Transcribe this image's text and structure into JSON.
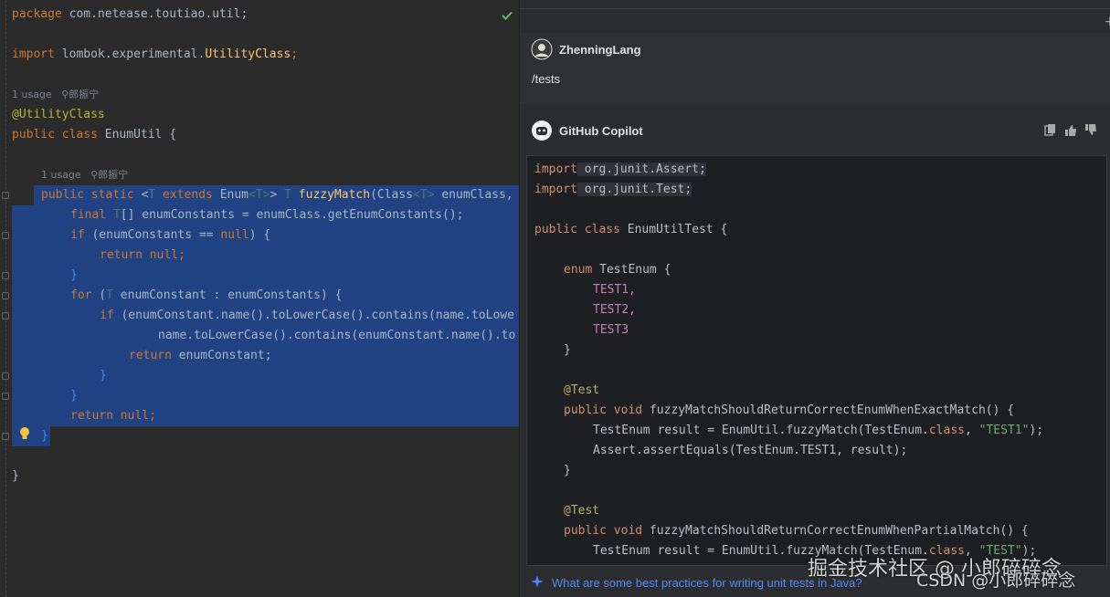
{
  "editor": {
    "line_package": "com.netease.toutiao.util;",
    "kw_package": "package",
    "kw_import": "import",
    "import_prefix": "lombok.experimental.",
    "import_class": "UtilityClass",
    "import_end": ";",
    "usage1": "1 usage",
    "author1": "郎振宁",
    "annotation": "@UtilityClass",
    "kw_public": "public",
    "kw_class": "class",
    "class_name": "EnumUtil {",
    "usage2": "1 usage",
    "author2": "郎振宁",
    "method_sig": {
      "kw1": "public static",
      "lt": "<",
      "t1": "T",
      "ext": " extends ",
      "enumT": "Enum",
      "t2": "<T>",
      "gt": "> ",
      "t3": "T",
      "name": "fuzzyMatch",
      "args": "(Class",
      "t4": "<T>",
      "rest": " enumClass,"
    },
    "l_final": "final",
    "l_final_t": "T",
    "l_final_rest": "[] enumConstants = enumClass.getEnumConstants();",
    "l_if": "if",
    "l_if_rest": " (enumConstants == ",
    "l_null": "null",
    "l_if_end": ") {",
    "l_return": "return",
    "l_return_null": " null;",
    "close_brace": "}",
    "l_for": "for",
    "l_for_t": "T",
    "l_for_rest": " enumConstant : enumConstants) {",
    "l_if2": "if",
    "l_if2_rest": " (enumConstant.name().toLowerCase().contains(name.toLowe",
    "l_cont": "name.toLowerCase().contains(enumConstant.name().to",
    "l_ret2": "return",
    "l_ret2_rest": " enumConstant;",
    "l_retnull": "return",
    "l_retnull_rest": " null;"
  },
  "chat": {
    "user_name": "ZhenningLang",
    "user_msg": "/tests",
    "copilot_name": "GitHub Copilot",
    "suggestion": "What are some best practices for writing unit tests in Java?",
    "code": {
      "imp1_kw": "import",
      "imp1_rest": " org.junit.Assert;",
      "imp2_kw": "import",
      "imp2_rest": " org.junit.Test;",
      "cls_kw": "public class",
      "cls_name": " EnumUtilTest {",
      "enum_kw": "enum",
      "enum_name": " TestEnum {",
      "e1": "TEST1,",
      "e2": "TEST2,",
      "e3": "TEST3",
      "close": "}",
      "test_ann": "@Test",
      "m1_kw": "public void",
      "m1_name": " fuzzyMatchShouldReturnCorrectEnumWhenExactMatch() {",
      "m1_l1a": "TestEnum result = EnumUtil.fuzzyMatch(TestEnum.",
      "m1_l1kw": "class",
      "m1_l1b": ", ",
      "m1_l1str": "\"TEST1\"",
      "m1_l1c": ");",
      "m1_l2": "Assert.assertEquals(TestEnum.TEST1, result);",
      "test_ann2": "@Test",
      "m2_kw": "public void",
      "m2_name": " fuzzyMatchShouldReturnCorrectEnumWhenPartialMatch() {",
      "m2_l1a": "TestEnum result = EnumUtil.fuzzyMatch(TestEnum.",
      "m2_l1kw": "class",
      "m2_l1b": ", ",
      "m2_l1str": "\"TEST\"",
      "m2_l1c": ");"
    }
  },
  "watermark": {
    "line1": "掘金技术社区 @ 小郎碎碎念",
    "line2": "CSDN @小郎碎碎念"
  },
  "icons": [
    "check-icon",
    "bulb-icon",
    "plus-icon",
    "avatar-user",
    "copilot-icon",
    "copy-icon",
    "thumbs-up-icon",
    "thumbs-down-icon",
    "sparkle-icon"
  ],
  "colors": {
    "selection": "#214283",
    "editor_bg": "#2b2b2b",
    "chat_bg": "#2b2d30",
    "link": "#548af7"
  }
}
